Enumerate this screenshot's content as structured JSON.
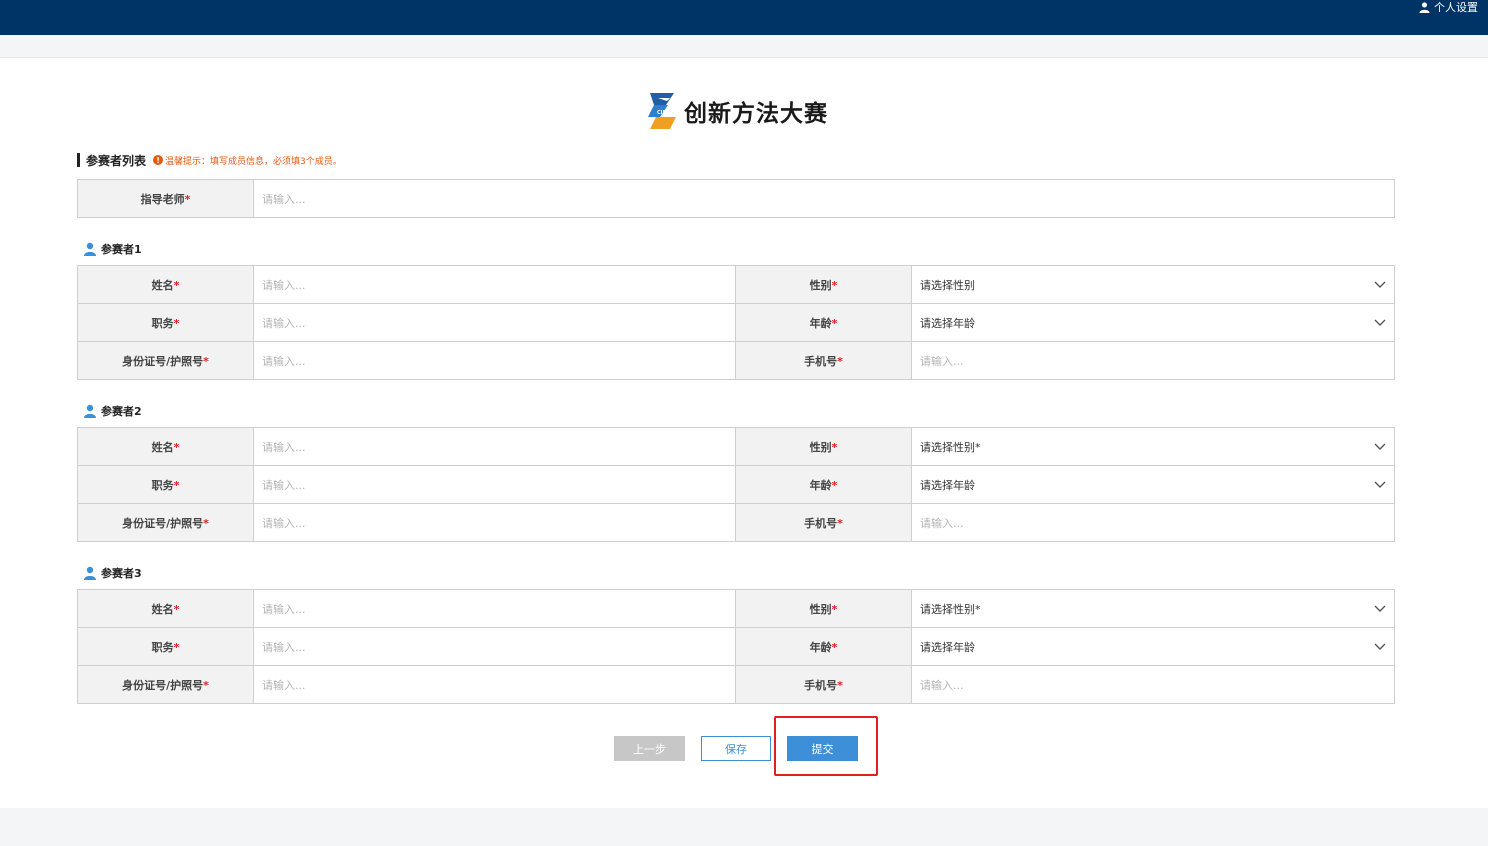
{
  "header": {
    "user_settings": "个人设置"
  },
  "brand": {
    "name": "创新方法大赛",
    "logo_caption": "CIMC"
  },
  "section": {
    "title": "参赛者列表",
    "tip": "温馨提示：填写成员信息，必须填3个成员。"
  },
  "advisor": {
    "label": "指导老师",
    "placeholder": "请输入..."
  },
  "participants": [
    {
      "title": "参赛者1",
      "name_label": "姓名",
      "name_placeholder": "请输入...",
      "gender_label": "性别",
      "gender_value": "请选择性别",
      "position_label": "职务",
      "position_placeholder": "请输入...",
      "age_label": "年龄",
      "age_value": "请选择年龄",
      "id_label": "身份证号/护照号",
      "id_placeholder": "请输入...",
      "phone_label": "手机号",
      "phone_placeholder": "请输入..."
    },
    {
      "title": "参赛者2",
      "name_label": "姓名",
      "name_placeholder": "请输入...",
      "gender_label": "性别",
      "gender_value": "请选择性别*",
      "position_label": "职务",
      "position_placeholder": "请输入...",
      "age_label": "年龄",
      "age_value": "请选择年龄",
      "id_label": "身份证号/护照号",
      "id_placeholder": "请输入...",
      "phone_label": "手机号",
      "phone_placeholder": "请输入..."
    },
    {
      "title": "参赛者3",
      "name_label": "姓名",
      "name_placeholder": "请输入...",
      "gender_label": "性别",
      "gender_value": "请选择性别*",
      "position_label": "职务",
      "position_placeholder": "请输入...",
      "age_label": "年龄",
      "age_value": "请选择年龄",
      "id_label": "身份证号/护照号",
      "id_placeholder": "请输入...",
      "phone_label": "手机号",
      "phone_placeholder": "请输入..."
    }
  ],
  "required_mark": "*",
  "buttons": {
    "prev": "上一步",
    "save": "保存",
    "submit": "提交"
  },
  "colors": {
    "header_bg": "#013466",
    "primary": "#3d8fd8",
    "required": "#e02020",
    "tip": "#e8590c",
    "highlight": "#e02020"
  }
}
